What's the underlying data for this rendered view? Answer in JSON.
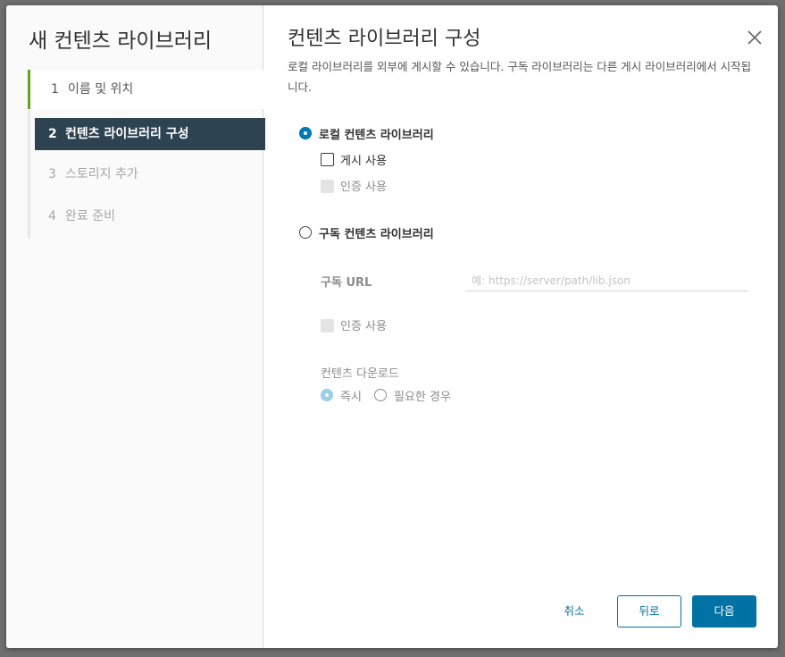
{
  "wizard": {
    "title": "새 컨텐츠 라이브러리",
    "steps": [
      {
        "num": "1",
        "label": "이름 및 위치",
        "state": "done"
      },
      {
        "num": "2",
        "label": "컨텐츠 라이브러리 구성",
        "state": "current"
      },
      {
        "num": "3",
        "label": "스토리지 추가",
        "state": "future"
      },
      {
        "num": "4",
        "label": "완료 준비",
        "state": "future"
      }
    ]
  },
  "main": {
    "title": "컨텐츠 라이브러리 구성",
    "description": "로컬 라이브러리를 외부에 게시할 수 있습니다. 구독 라이브러리는 다른 게시 라이브러리에서 시작됩니다.",
    "local_library": {
      "label": "로컬 컨텐츠 라이브러리",
      "selected": true,
      "publish_label": "게시 사용",
      "publish_checked": false,
      "auth_label": "인증 사용",
      "auth_enabled": false
    },
    "subscribed_library": {
      "label": "구독 컨텐츠 라이브러리",
      "selected": false,
      "url_label": "구독 URL",
      "url_value": "",
      "url_placeholder": "예: https://server/path/lib.json",
      "auth_label": "인증 사용",
      "download_label": "컨텐츠 다운로드",
      "download_options": [
        "즉시",
        "필요한 경우"
      ],
      "download_selected": "즉시"
    }
  },
  "footer": {
    "cancel_label": "취소",
    "back_label": "뒤로",
    "next_label": "다음"
  },
  "colors": {
    "accent": "#0072a3",
    "step_done": "#62a420",
    "step_current_bg": "#2e4352"
  }
}
